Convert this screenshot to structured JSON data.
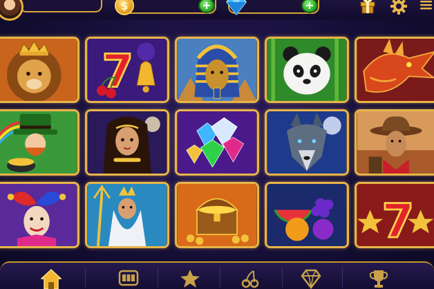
{
  "header": {
    "coin_symbol": "$",
    "icons": [
      "avatar",
      "coin-icon",
      "plus-icon",
      "diamond-icon",
      "plus-icon",
      "gift-icon",
      "gear-icon",
      "menu-icon"
    ]
  },
  "tiles": [
    {
      "id": "lion-king",
      "icon": "lion-crown-icon"
    },
    {
      "id": "lucky-seven-bell",
      "icon": "seven-cherry-bell-icon"
    },
    {
      "id": "pharaoh",
      "icon": "pharaoh-icon"
    },
    {
      "id": "panda",
      "icon": "panda-icon"
    },
    {
      "id": "dragon",
      "icon": "dragon-icon"
    },
    {
      "id": "leprechaun",
      "icon": "leprechaun-icon"
    },
    {
      "id": "goddess",
      "icon": "goddess-icon"
    },
    {
      "id": "gems",
      "icon": "gems-icon"
    },
    {
      "id": "wolf",
      "icon": "wolf-icon"
    },
    {
      "id": "cowboy",
      "icon": "cowboy-icon"
    },
    {
      "id": "jester",
      "icon": "jester-icon"
    },
    {
      "id": "poseidon",
      "icon": "poseidon-icon"
    },
    {
      "id": "treasure-chest",
      "icon": "treasure-chest-icon"
    },
    {
      "id": "fruits",
      "icon": "fruits-icon"
    },
    {
      "id": "lucky-seven-star",
      "icon": "seven-star-icon"
    }
  ],
  "bottom_nav": {
    "items": [
      {
        "id": "home",
        "icon": "home-icon",
        "active": true
      },
      {
        "id": "slots",
        "icon": "slot-machine-icon",
        "active": false
      },
      {
        "id": "favorites",
        "icon": "star-icon",
        "active": false
      },
      {
        "id": "fruit",
        "icon": "cherry-icon",
        "active": false
      },
      {
        "id": "vip",
        "icon": "diamond-icon",
        "active": false
      },
      {
        "id": "tournaments",
        "icon": "trophy-icon",
        "active": false
      }
    ]
  },
  "colors": {
    "frame_gold": "#e8b54a",
    "background": "#160f38",
    "accent_green": "#2fb12a",
    "diamond_blue": "#3fb6ff"
  }
}
